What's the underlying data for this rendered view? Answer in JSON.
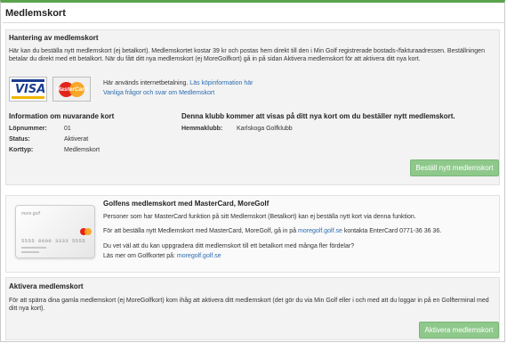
{
  "page": {
    "title": "Medlemskort"
  },
  "ordering": {
    "heading": "Hantering av medlemskort",
    "text": "Här kan du beställa nytt medlemskort (ej betalkort). Medlemskortet kostar 39 kr och postas hem direkt till den i Min Golf registrerade bostads-/fakturaadressen. Beställningen betalar du direkt med ett betalkort. När du fått ditt nya medlemskort (ej MoreGolfkort) gå in på sidan Aktivera medlemskort för att aktivera ditt nya kort.",
    "visa_label": "VISA",
    "mastercard_label": "MasterCard",
    "payment_note": "Här används internetbetalning.",
    "purchase_info_link": "Läs köpinformation här",
    "faq_link": "Vanliga frågor och svar om Medlemskort"
  },
  "current_card": {
    "heading": "Information om nuvarande kort",
    "rows": [
      {
        "label": "Löpnummer:",
        "value": "01"
      },
      {
        "label": "Status:",
        "value": "Aktiverat"
      },
      {
        "label": "Korttyp:",
        "value": "Medlemskort"
      }
    ]
  },
  "club": {
    "heading": "Denna klubb kommer att visas på ditt nya kort om du beställer nytt medlemskort.",
    "label": "Hemmaklubb:",
    "value": "Karlskoga Golfklubb"
  },
  "order_button": "Beställ nytt medlemskort",
  "moregolf": {
    "heading": "Golfens medlemskort med MasterCard, MoreGolf",
    "card_brand": "more golf",
    "card_number": "5555 0000 3333 5555",
    "p1": "Personer som har MasterCard funktion på sitt Medlemskort (Betalkort) kan ej beställa nytt kort via denna funktion.",
    "p2_pre": "För att beställa nytt Medlemskort med MasterCard, MoreGolf, gå in på",
    "p2_link": "moregolf.golf.se",
    "p2_post": "kontakta EnterCard 0771-36 36 36.",
    "p3": "Du vet väl att du kan uppgradera ditt medlemskort till ett betalkort med många fler fördelar?",
    "p4_pre": "Läs mer om Golfkortet på:",
    "p4_link": "moregolf.golf.se"
  },
  "activate": {
    "heading": "Aktivera medlemskort",
    "text": "För att spärra dina gamla medlemskort (ej MoreGolfkort) kom ihåg att aktivera ditt medlemskort (det gör du via Min Golf eller i och med att du loggar in på en Golfterminal med ditt nya kort).",
    "button": "Aktivera medlemskort"
  },
  "colors": {
    "accent": "#5aa34c",
    "button": "#8ec98b",
    "link": "#2b6cb0"
  }
}
